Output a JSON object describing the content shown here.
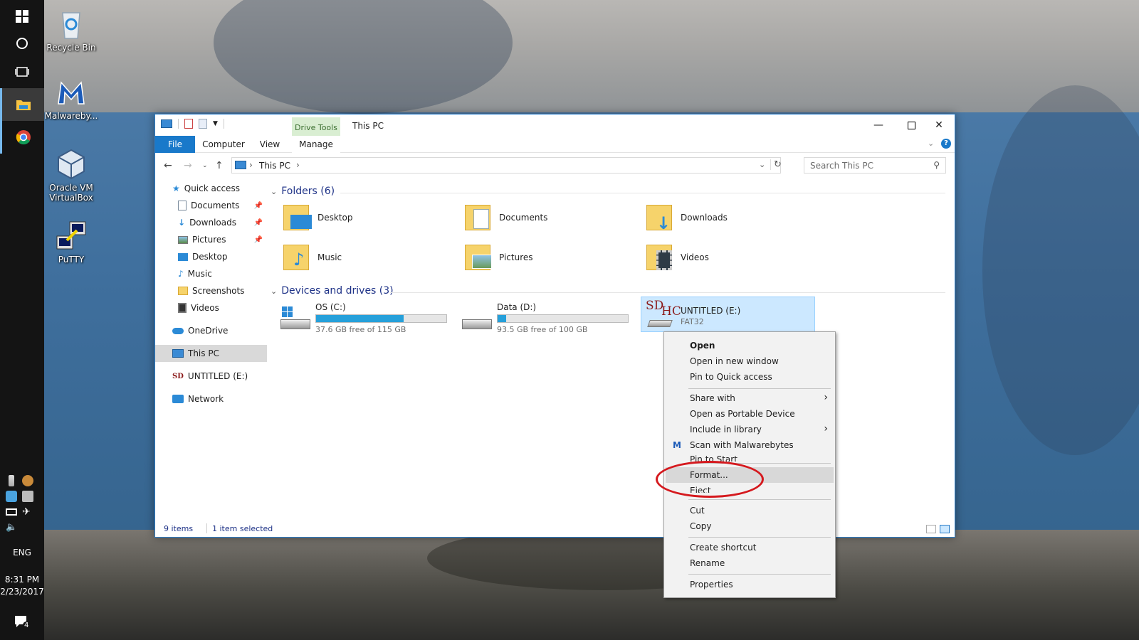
{
  "desktop": {
    "icons": [
      {
        "label": "Recycle Bin"
      },
      {
        "label": "Malwareby..."
      },
      {
        "label": "Oracle VM VirtualBox"
      },
      {
        "label": "PuTTY"
      }
    ]
  },
  "taskbar": {
    "language": "ENG",
    "time": "8:31 PM",
    "date": "2/23/2017",
    "notification_count": "4"
  },
  "window": {
    "contextual_tab_group": "Drive Tools",
    "title": "This PC",
    "ribbon_tabs": [
      "File",
      "Computer",
      "View",
      "Manage"
    ],
    "address_crumb": "This PC",
    "search_placeholder": "Search This PC",
    "status_items": "9 items",
    "status_selected": "1 item selected"
  },
  "nav": {
    "quick_access": "Quick access",
    "pinned": [
      {
        "label": "Documents",
        "pinned": true
      },
      {
        "label": "Downloads",
        "pinned": true
      },
      {
        "label": "Pictures",
        "pinned": true
      },
      {
        "label": "Desktop",
        "pinned": false
      },
      {
        "label": "Music",
        "pinned": false
      },
      {
        "label": "Screenshots",
        "pinned": false
      },
      {
        "label": "Videos",
        "pinned": false
      }
    ],
    "onedrive": "OneDrive",
    "this_pc": "This PC",
    "untitled": "UNTITLED (E:)",
    "network": "Network"
  },
  "content": {
    "folders_header": "Folders (6)",
    "folders": [
      {
        "label": "Desktop"
      },
      {
        "label": "Documents"
      },
      {
        "label": "Downloads"
      },
      {
        "label": "Music"
      },
      {
        "label": "Pictures"
      },
      {
        "label": "Videos"
      }
    ],
    "devices_header": "Devices and drives (3)",
    "drives": [
      {
        "name": "OS (C:)",
        "free": "37.6 GB free of 115 GB",
        "used_fraction": 0.673
      },
      {
        "name": "Data (D:)",
        "free": "93.5 GB free of 100 GB",
        "used_fraction": 0.065
      },
      {
        "name": "UNTITLED (E:)",
        "subtitle": "FAT32",
        "badge_sd": "SD",
        "badge_hc": "HC"
      }
    ]
  },
  "context_menu": {
    "items": [
      {
        "label": "Open"
      },
      {
        "label": "Open in new window"
      },
      {
        "label": "Pin to Quick access"
      },
      {
        "label": "Share with"
      },
      {
        "label": "Open as Portable Device"
      },
      {
        "label": "Include in library"
      },
      {
        "label": "Scan with Malwarebytes"
      },
      {
        "label": "Pin to Start"
      },
      {
        "label": "Format..."
      },
      {
        "label": "Eject"
      },
      {
        "label": "Cut"
      },
      {
        "label": "Copy"
      },
      {
        "label": "Create shortcut"
      },
      {
        "label": "Rename"
      },
      {
        "label": "Properties"
      }
    ]
  },
  "colors": {
    "accent": "#1979ca",
    "selection": "#cce8ff",
    "drive_bar": "#26a0da",
    "annotation": "#d5191e"
  }
}
